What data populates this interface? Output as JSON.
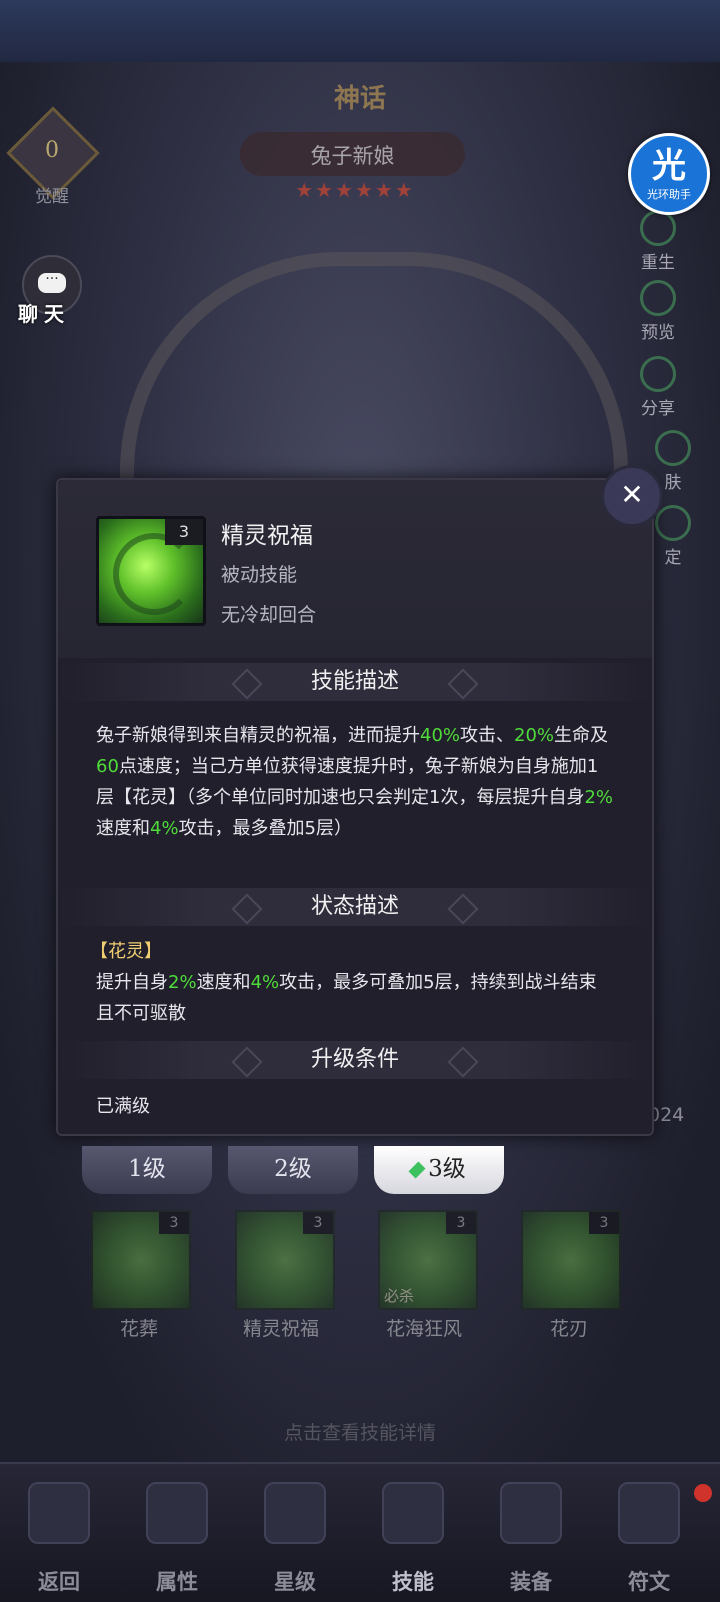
{
  "hero": {
    "rank": "神话",
    "name": "兔子新娘",
    "stars": "★★★★★★",
    "awaken_count": "0",
    "awaken_label": "觉醒"
  },
  "chat": {
    "label": "聊天",
    "icon": "chat-bubble-icon"
  },
  "helper": {
    "big": "光",
    "small": "光环助手"
  },
  "side_menu": [
    {
      "label": "重生",
      "icon": "rebirth-icon"
    },
    {
      "label": "预览",
      "icon": "preview-icon"
    },
    {
      "label": "分享",
      "icon": "share-icon"
    },
    {
      "label": "肤",
      "icon": "skin-icon"
    },
    {
      "label": "定",
      "icon": "lock-icon"
    }
  ],
  "background_fragment": "024",
  "skill_popup": {
    "icon_level": "3",
    "name": "精灵祝福",
    "type": "被动技能",
    "cooldown": "无冷却回合",
    "section_desc_title": "技能描述",
    "desc_parts": [
      {
        "t": "兔子新娘得到来自精灵的祝福，进而提升",
        "c": ""
      },
      {
        "t": "40%",
        "c": "hl"
      },
      {
        "t": "攻击、",
        "c": ""
      },
      {
        "t": "20%",
        "c": "hl"
      },
      {
        "t": "生命及",
        "c": ""
      },
      {
        "t": "60",
        "c": "hl"
      },
      {
        "t": "点速度；当己方单位获得速度提升时，兔子新娘为自身施加1层【花灵】（多个单位同时加速也只会判定1次，每层提升自身",
        "c": ""
      },
      {
        "t": "2%",
        "c": "hl"
      },
      {
        "t": "速度和",
        "c": ""
      },
      {
        "t": "4%",
        "c": "hl"
      },
      {
        "t": "攻击，最多叠加5层）",
        "c": ""
      }
    ],
    "section_status_title": "状态描述",
    "status_name": "【花灵】",
    "status_parts": [
      {
        "t": "提升自身",
        "c": ""
      },
      {
        "t": "2%",
        "c": "hl"
      },
      {
        "t": "速度和",
        "c": ""
      },
      {
        "t": "4%",
        "c": "hl"
      },
      {
        "t": "攻击，最多可叠加5层，持续到战斗结束且不可驱散",
        "c": ""
      }
    ],
    "section_upgrade_title": "升级条件",
    "upgrade_text": "已满级",
    "close_icon": "close-x-icon"
  },
  "level_tabs": [
    {
      "label": "1级",
      "active": false
    },
    {
      "label": "2级",
      "active": false
    },
    {
      "label": "3级",
      "active": true
    }
  ],
  "skills": [
    {
      "name": "花葬",
      "level": "3",
      "tag": ""
    },
    {
      "name": "精灵祝福",
      "level": "3",
      "tag": ""
    },
    {
      "name": "花海狂风",
      "level": "3",
      "tag": "必杀"
    },
    {
      "name": "花刃",
      "level": "3",
      "tag": ""
    }
  ],
  "hint": "点击查看技能详情",
  "bottom_nav": [
    {
      "label": "返回",
      "icon": "back-arrow-icon"
    },
    {
      "label": "属性",
      "icon": "hooded-figure-icon"
    },
    {
      "label": "星级",
      "icon": "star-emblem-icon"
    },
    {
      "label": "技能",
      "icon": "skill-book-icon",
      "active": true
    },
    {
      "label": "装备",
      "icon": "crossed-swords-icon"
    },
    {
      "label": "符文",
      "icon": "rune-icon"
    }
  ],
  "colors": {
    "highlight": "#4fdc3a",
    "status_name": "#f0cf72",
    "helper_blue": "#1a73d6"
  }
}
